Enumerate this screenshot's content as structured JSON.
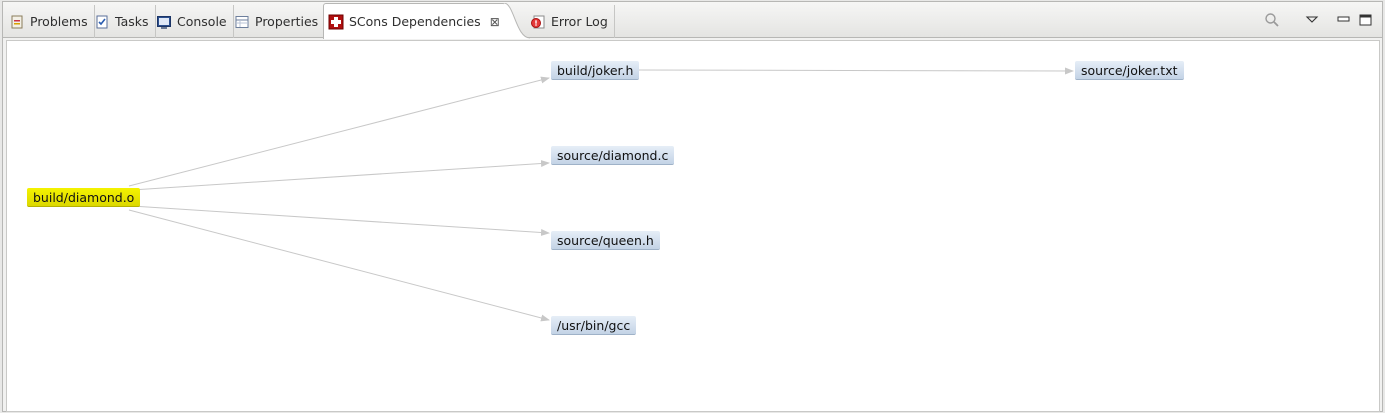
{
  "tabs": [
    {
      "label": "Problems",
      "icon": "problems-icon"
    },
    {
      "label": "Tasks",
      "icon": "tasks-icon"
    },
    {
      "label": "Console",
      "icon": "console-icon"
    },
    {
      "label": "Properties",
      "icon": "properties-icon"
    },
    {
      "label": "SCons Dependencies",
      "icon": "scons-icon",
      "active": true,
      "close": "⊠"
    },
    {
      "label": "Error Log",
      "icon": "error-log-icon"
    }
  ],
  "toolbar": {
    "search_icon": "search-icon",
    "menu_icon": "view-menu-icon",
    "minimize_icon": "minimize-icon",
    "maximize_icon": "maximize-icon"
  },
  "graph": {
    "root": "build/diamond.o",
    "nodes": [
      {
        "id": "root",
        "label": "build/diamond.o"
      },
      {
        "id": "joker_h",
        "label": "build/joker.h"
      },
      {
        "id": "diamond_c",
        "label": "source/diamond.c"
      },
      {
        "id": "queen_h",
        "label": "source/queen.h"
      },
      {
        "id": "gcc",
        "label": "/usr/bin/gcc"
      },
      {
        "id": "joker_txt",
        "label": "source/joker.txt"
      }
    ],
    "edges": [
      {
        "from": "root",
        "to": "joker_h"
      },
      {
        "from": "root",
        "to": "diamond_c"
      },
      {
        "from": "root",
        "to": "queen_h"
      },
      {
        "from": "root",
        "to": "gcc"
      },
      {
        "from": "joker_h",
        "to": "joker_txt"
      }
    ]
  },
  "colors": {
    "root_node": "#e8e600",
    "dependency_node": "#cfdcec",
    "edge": "#c8c8c8"
  }
}
